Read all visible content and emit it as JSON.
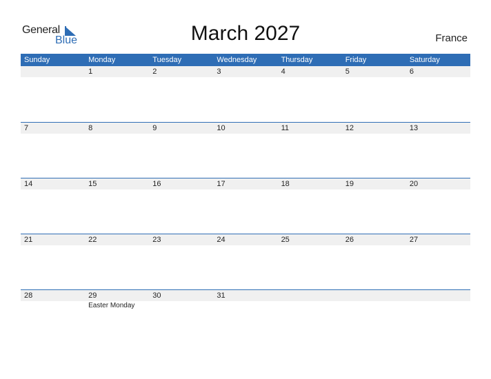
{
  "logo": {
    "general": "General",
    "blue": "Blue"
  },
  "title": "March 2027",
  "country": "France",
  "weekdays": [
    "Sunday",
    "Monday",
    "Tuesday",
    "Wednesday",
    "Thursday",
    "Friday",
    "Saturday"
  ],
  "weeks": [
    {
      "days": [
        "",
        "1",
        "2",
        "3",
        "4",
        "5",
        "6"
      ],
      "events": [
        "",
        "",
        "",
        "",
        "",
        "",
        ""
      ]
    },
    {
      "days": [
        "7",
        "8",
        "9",
        "10",
        "11",
        "12",
        "13"
      ],
      "events": [
        "",
        "",
        "",
        "",
        "",
        "",
        ""
      ]
    },
    {
      "days": [
        "14",
        "15",
        "16",
        "17",
        "18",
        "19",
        "20"
      ],
      "events": [
        "",
        "",
        "",
        "",
        "",
        "",
        ""
      ]
    },
    {
      "days": [
        "21",
        "22",
        "23",
        "24",
        "25",
        "26",
        "27"
      ],
      "events": [
        "",
        "",
        "",
        "",
        "",
        "",
        ""
      ]
    },
    {
      "days": [
        "28",
        "29",
        "30",
        "31",
        "",
        "",
        ""
      ],
      "events": [
        "",
        "Easter Monday",
        "",
        "",
        "",
        "",
        ""
      ]
    }
  ],
  "colors": {
    "accent": "#2e6db5",
    "row_bg": "#f0f0f0"
  }
}
